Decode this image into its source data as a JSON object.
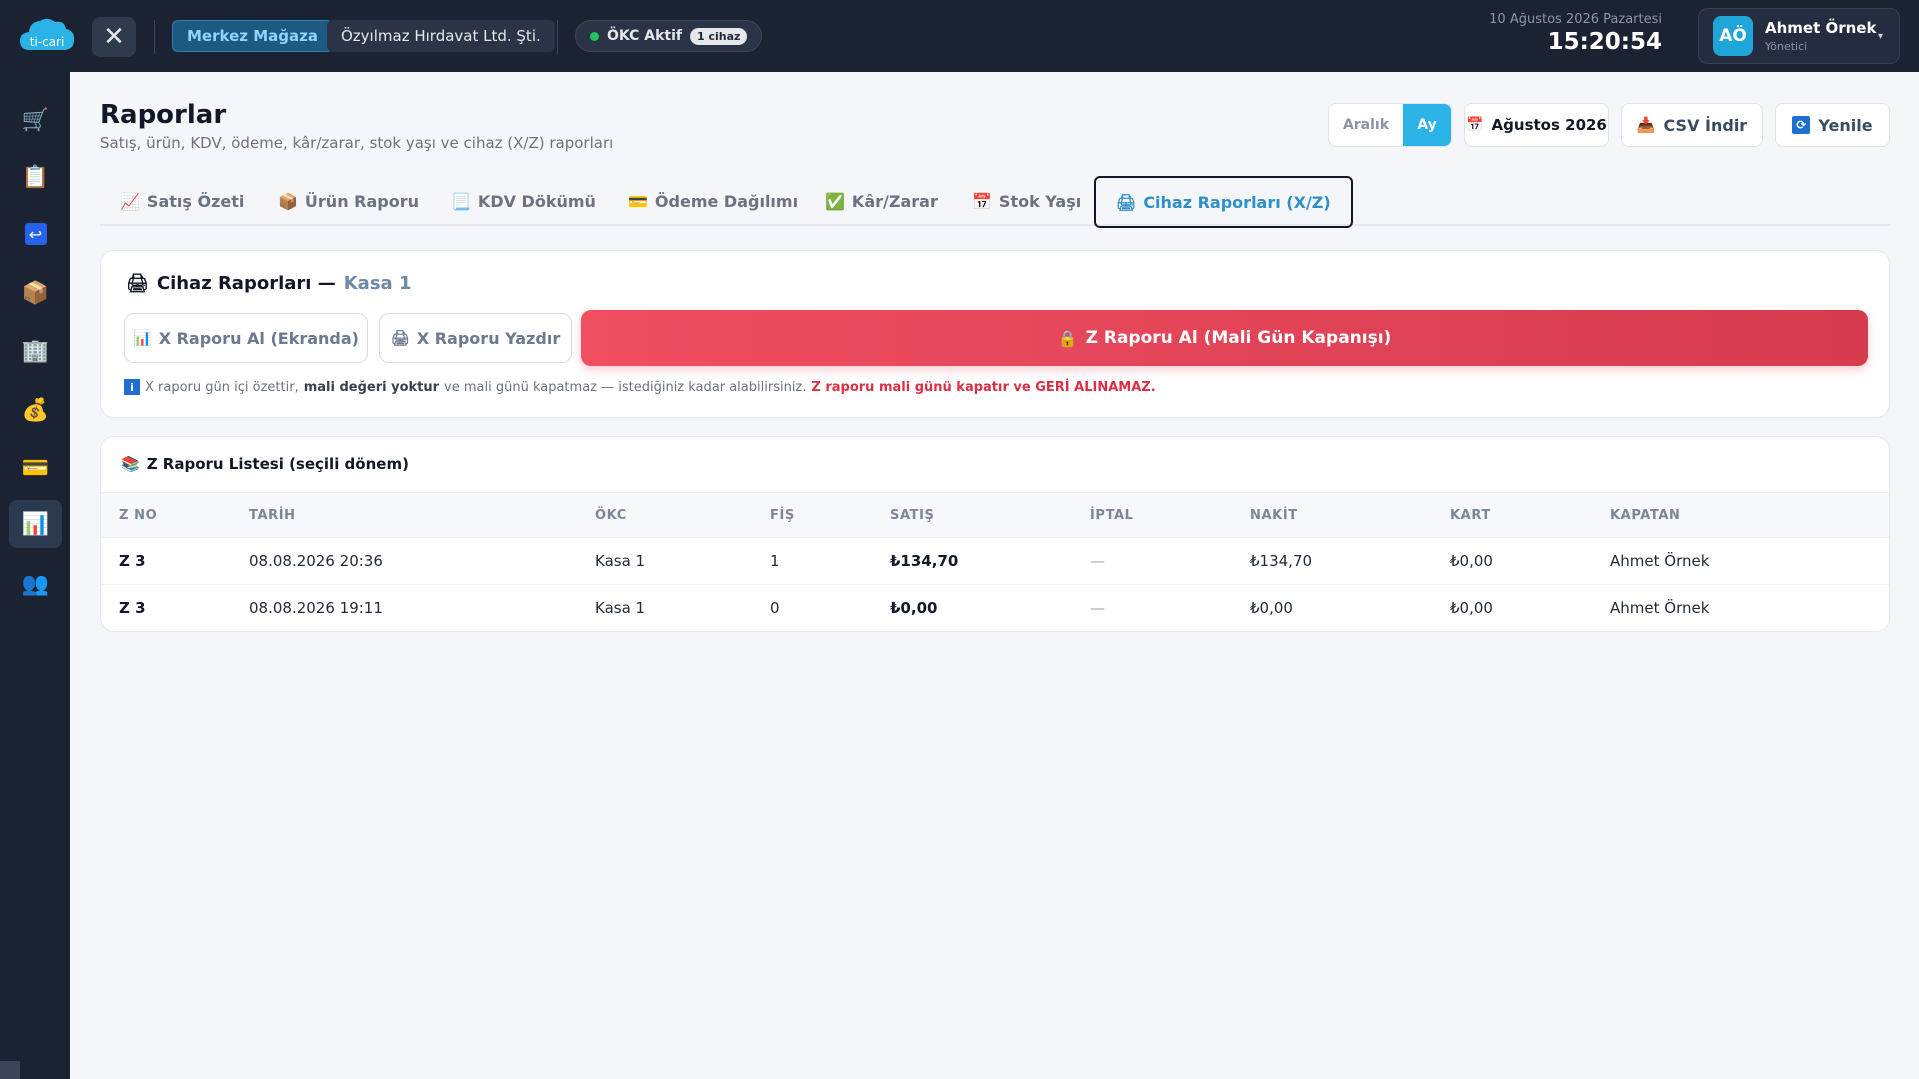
{
  "app": {
    "logo_text": "ti-cari",
    "close_symbol": "✕",
    "store": "Merkez Mağaza",
    "company": "Özyılmaz Hırdavat Ltd. Şti.",
    "okc_status": "ÖKC Aktif",
    "okc_devices": "1 cihaz",
    "date": "10 Ağustos 2026 Pazartesi",
    "time": "15:20:54",
    "user": {
      "initials": "AÖ",
      "name": "Ahmet Örnek",
      "role": "Yönetici"
    },
    "colors": {
      "topbar": "#1b2333",
      "accent": "#2bb3e8",
      "danger": "#e8475a",
      "success": "#22c55e"
    }
  },
  "sidebar": {
    "items": [
      {
        "icon": "cart-icon",
        "glyph": "🛒"
      },
      {
        "icon": "clipboard-icon",
        "glyph": "📋"
      },
      {
        "icon": "return-icon",
        "glyph": "↩"
      },
      {
        "icon": "package-icon",
        "glyph": "📦"
      },
      {
        "icon": "building-icon",
        "glyph": "🏢"
      },
      {
        "icon": "money-bag-icon",
        "glyph": "💰"
      },
      {
        "icon": "credit-card-icon",
        "glyph": "💳"
      },
      {
        "icon": "bar-chart-icon",
        "glyph": "📊",
        "active": true
      },
      {
        "icon": "users-icon",
        "glyph": "👥"
      }
    ]
  },
  "page": {
    "title": "Raporlar",
    "subtitle": "Satış, ürün, KDV, ödeme, kâr/zarar, stok yaşı ve cihaz (X/Z) raporları"
  },
  "toolbar": {
    "range_label": "Aralık",
    "month_label": "Ay",
    "selected_month": "Ağustos 2026",
    "csv_label": "CSV İndir",
    "refresh_label": "Yenile"
  },
  "tabs": [
    {
      "label": "Satış Özeti",
      "icon": "📈"
    },
    {
      "label": "Ürün Raporu",
      "icon": "📦"
    },
    {
      "label": "KDV Dökümü",
      "icon": "📃"
    },
    {
      "label": "Ödeme Dağılımı",
      "icon": "💳"
    },
    {
      "label": "Kâr/Zarar",
      "icon": "✅"
    },
    {
      "label": "Stok Yaşı",
      "icon": "📅"
    },
    {
      "label": "Cihaz Raporları (X/Z)",
      "icon": "🖨",
      "active": true
    }
  ],
  "device_reports": {
    "title": "Cihaz Raporları —",
    "device": "Kasa 1",
    "x_screen_label": "X Raporu Al (Ekranda)",
    "x_print_label": "X Raporu Yazdır",
    "z_label": "Z Raporu Al (Mali Gün Kapanışı)",
    "info": {
      "part1": "X raporu gün içi özettir,",
      "bold": "mali değeri yoktur",
      "part2": "ve mali günü kapatmaz — istediğiniz kadar alabilirsiniz.",
      "danger": "Z raporu mali günü kapatır ve GERİ ALINAMAZ."
    }
  },
  "z_list": {
    "title": "Z Raporu Listesi (seçili dönem)",
    "columns": [
      "Z NO",
      "TARİH",
      "ÖKC",
      "FİŞ",
      "SATIŞ",
      "İPTAL",
      "NAKİT",
      "KART",
      "KAPATAN"
    ],
    "rows": [
      {
        "z_no": "Z 3",
        "date": "08.08.2026 20:36",
        "okc": "Kasa 1",
        "receipts": "1",
        "sales": "₺134,70",
        "void": "—",
        "cash": "₺134,70",
        "card": "₺0,00",
        "closed_by": "Ahmet Örnek"
      },
      {
        "z_no": "Z 3",
        "date": "08.08.2026 19:11",
        "okc": "Kasa 1",
        "receipts": "0",
        "sales": "₺0,00",
        "void": "—",
        "cash": "₺0,00",
        "card": "₺0,00",
        "closed_by": "Ahmet Örnek"
      }
    ]
  }
}
